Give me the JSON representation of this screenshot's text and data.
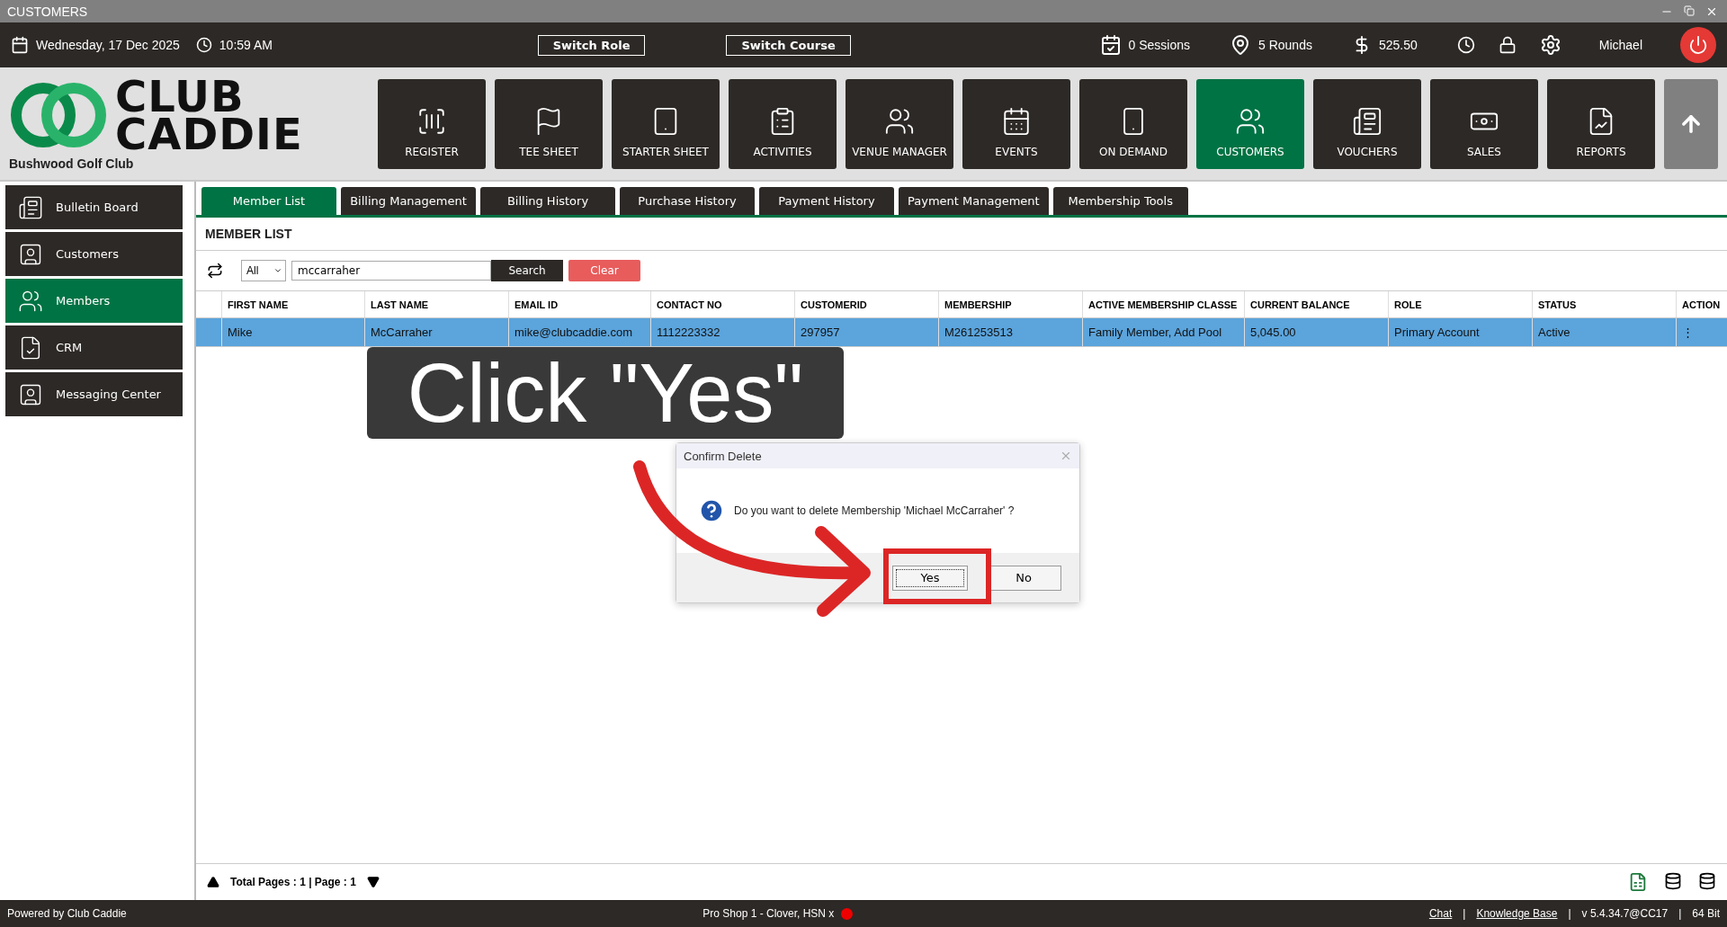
{
  "window": {
    "title": "CUSTOMERS"
  },
  "top_bar": {
    "date": "Wednesday,  17 Dec 2025",
    "time": "10:59 AM",
    "buttons": [
      "Switch Role",
      "Switch Course"
    ],
    "sessions": "0 Sessions",
    "rounds": "5 Rounds",
    "balance": "525.50",
    "user": "Michael"
  },
  "logo": {
    "line1": "CLUB",
    "line2": "CADDIE",
    "club": "Bushwood Golf Club"
  },
  "nav": [
    {
      "label": "REGISTER",
      "selected": false
    },
    {
      "label": "TEE SHEET",
      "selected": false
    },
    {
      "label": "STARTER SHEET",
      "selected": false
    },
    {
      "label": "ACTIVITIES",
      "selected": false
    },
    {
      "label": "VENUE MANAGER",
      "selected": false
    },
    {
      "label": "EVENTS",
      "selected": false
    },
    {
      "label": "ON DEMAND",
      "selected": false
    },
    {
      "label": "CUSTOMERS",
      "selected": true
    },
    {
      "label": "VOUCHERS",
      "selected": false
    },
    {
      "label": "SALES",
      "selected": false
    },
    {
      "label": "REPORTS",
      "selected": false
    }
  ],
  "sidebar": {
    "items": [
      {
        "label": "Bulletin Board",
        "selected": false
      },
      {
        "label": "Customers",
        "selected": false
      },
      {
        "label": "Members",
        "selected": true
      },
      {
        "label": "CRM",
        "selected": false
      },
      {
        "label": "Messaging Center",
        "selected": false
      }
    ]
  },
  "tabs": [
    {
      "label": "Member List",
      "selected": true
    },
    {
      "label": "Billing Management",
      "selected": false
    },
    {
      "label": "Billing History",
      "selected": false
    },
    {
      "label": "Purchase History",
      "selected": false
    },
    {
      "label": "Payment History",
      "selected": false
    },
    {
      "label": "Payment Management",
      "selected": false
    },
    {
      "label": "Membership Tools",
      "selected": false
    }
  ],
  "section_title": "MEMBER LIST",
  "filter": {
    "scope": "All",
    "query": "mccarraher",
    "search_button": "Search",
    "clear_button": "Clear"
  },
  "table": {
    "columns": [
      "FIRST NAME",
      "LAST NAME",
      "EMAIL ID",
      "CONTACT NO",
      "CUSTOMERID",
      "MEMBERSHIP",
      "ACTIVE MEMBERSHIP CLASSE",
      "CURRENT BALANCE",
      "ROLE",
      "STATUS",
      "ACTION"
    ],
    "rows": [
      {
        "selected": true,
        "cells": [
          "Mike",
          "McCarraher",
          "mike@clubcaddie.com",
          "1112223332",
          "297957",
          "M261253513",
          "Family Member, Add Pool",
          "5,045.00",
          "Primary Account",
          "Active",
          "⋮"
        ]
      }
    ]
  },
  "pagination": "Total Pages : 1 | Page : 1",
  "dialog": {
    "title": "Confirm Delete",
    "message": "Do you want to delete Membership 'Michael McCarraher' ?",
    "buttons": [
      {
        "label": "Yes",
        "selected": true
      },
      {
        "label": "No",
        "selected": false
      }
    ]
  },
  "annotation": {
    "text": "Click \"Yes\""
  },
  "status_bar": {
    "powered": "Powered by Club Caddie",
    "terminal": "Pro Shop 1 - Clover, HSN x",
    "items": [
      {
        "kind": "link",
        "text": "Chat"
      },
      {
        "kind": "separator",
        "text": "|"
      },
      {
        "kind": "link",
        "text": "Knowledge Base"
      },
      {
        "kind": "separator",
        "text": "|"
      },
      {
        "kind": "text",
        "text": "v 5.4.34.7@CC17"
      },
      {
        "kind": "separator",
        "text": "|"
      },
      {
        "kind": "text",
        "text": "64 Bit"
      }
    ]
  }
}
